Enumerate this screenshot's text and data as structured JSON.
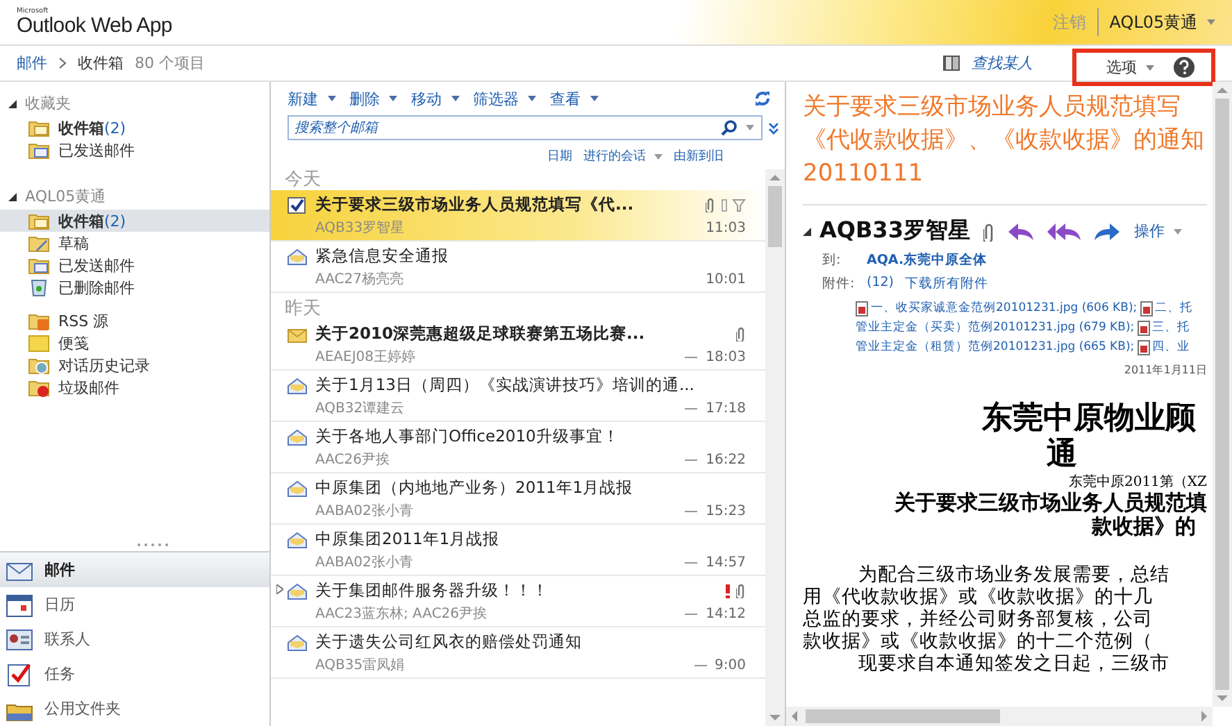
{
  "header": {
    "logo_small": "Microsoft",
    "logo": "Outlook Web App",
    "signout": "注销",
    "user": "AQL05黄通"
  },
  "breadcrumb": {
    "root": "邮件",
    "folder": "收件箱",
    "count": "80 个项目",
    "find_people": "查找某人",
    "options": "选项"
  },
  "favorites": {
    "title": "收藏夹",
    "expanded": true,
    "items": [
      {
        "label": "收件箱",
        "count": "(2)",
        "kind": "inbox",
        "selected": false,
        "bold": true
      },
      {
        "label": "已发送邮件",
        "kind": "sent",
        "selected": false,
        "bold": false
      }
    ]
  },
  "mailbox": {
    "title": "AQL05黄通",
    "expanded": true,
    "items": [
      {
        "label": "收件箱",
        "count": "(2)",
        "kind": "inbox",
        "selected": true,
        "bold": true
      },
      {
        "label": "草稿",
        "kind": "drafts",
        "selected": false,
        "bold": false
      },
      {
        "label": "已发送邮件",
        "kind": "sent",
        "selected": false,
        "bold": false
      },
      {
        "label": "已删除邮件",
        "kind": "deleted",
        "selected": false,
        "bold": false
      },
      {
        "label": "RSS 源",
        "kind": "rss",
        "selected": false,
        "bold": false
      },
      {
        "label": "便笺",
        "kind": "notes",
        "selected": false,
        "bold": false
      },
      {
        "label": "对话历史记录",
        "kind": "history",
        "selected": false,
        "bold": false
      },
      {
        "label": "垃圾邮件",
        "kind": "junk",
        "selected": false,
        "bold": false
      }
    ]
  },
  "nav": [
    {
      "label": "邮件",
      "kind": "mail",
      "selected": true
    },
    {
      "label": "日历",
      "kind": "calendar",
      "selected": false
    },
    {
      "label": "联系人",
      "kind": "contacts",
      "selected": false
    },
    {
      "label": "任务",
      "kind": "tasks",
      "selected": false
    },
    {
      "label": "公用文件夹",
      "kind": "public",
      "selected": false
    }
  ],
  "toolbar": [
    "新建",
    "删除",
    "移动",
    "筛选器",
    "查看"
  ],
  "search": {
    "placeholder": "搜索整个邮箱"
  },
  "sort": {
    "by": "日期",
    "group": "进行的会话",
    "order": "由新到旧"
  },
  "groups": [
    {
      "title": "今天",
      "messages": [
        {
          "subject": "关于要求三级市场业务人员规范填写《代...",
          "sender": "AQB33罗智星",
          "time": "11:03",
          "kind": "checked",
          "unread": true,
          "selected": true,
          "attachment": true,
          "important": false,
          "dash": false,
          "conversation": false
        },
        {
          "subject": "紧急信息安全通报",
          "sender": "AAC27杨亮亮",
          "time": "10:01",
          "kind": "read",
          "unread": false,
          "selected": false,
          "attachment": false,
          "important": false,
          "dash": false,
          "conversation": false
        }
      ]
    },
    {
      "title": "昨天",
      "messages": [
        {
          "subject": "关于2010深莞惠超级足球联赛第五场比赛...",
          "sender": "AEAEJ08王婷婷",
          "time": "18:03",
          "kind": "unread",
          "unread": true,
          "selected": false,
          "attachment": true,
          "important": false,
          "dash": true,
          "conversation": false
        },
        {
          "subject": "关于1月13日（周四）《实战演讲技巧》培训的通...",
          "sender": "AQB32谭建云",
          "time": "17:18",
          "kind": "read",
          "unread": false,
          "selected": false,
          "attachment": false,
          "important": false,
          "dash": true,
          "conversation": false
        },
        {
          "subject": "关于各地人事部门Office2010升级事宜！",
          "sender": "AAC26尹挨",
          "time": "16:22",
          "kind": "read",
          "unread": false,
          "selected": false,
          "attachment": false,
          "important": false,
          "dash": true,
          "conversation": false
        },
        {
          "subject": "中原集团（内地地产业务）2011年1月战报",
          "sender": "AABA02张小青",
          "time": "15:23",
          "kind": "read",
          "unread": false,
          "selected": false,
          "attachment": false,
          "important": false,
          "dash": true,
          "conversation": false
        },
        {
          "subject": "中原集团2011年1月战报",
          "sender": "AABA02张小青",
          "time": "14:57",
          "kind": "read",
          "unread": false,
          "selected": false,
          "attachment": false,
          "important": false,
          "dash": true,
          "conversation": false
        },
        {
          "subject": "关于集团邮件服务器升级！！！",
          "sender": "AAC23蓝东林; AAC26尹挨",
          "time": "14:12",
          "kind": "read",
          "unread": false,
          "selected": false,
          "attachment": true,
          "important": true,
          "dash": true,
          "conversation": true
        },
        {
          "subject": "关于遗失公司红风衣的赔偿处罚通知",
          "sender": "AQB35雷凤娟",
          "time": "9:00",
          "kind": "read",
          "unread": false,
          "selected": false,
          "attachment": false,
          "important": false,
          "dash": true,
          "conversation": false
        }
      ]
    }
  ],
  "reading": {
    "subject": "关于要求三级市场业务人员规范填写《代收款收据》、《收款收据》的通知20110111",
    "sender": "AQB33罗智星",
    "actions": "操作",
    "to_label": "到:",
    "to": "AQA.东莞中原全体",
    "att_label": "附件:",
    "att_count": "(12)",
    "download": "下载所有附件",
    "attachment_lines": [
      [
        {
          "text": "一、收买家诚意金范例20101231.jpg (606 KB);",
          "icon": true
        },
        {
          "text": "二、托",
          "icon": true
        }
      ],
      [
        {
          "text": "管业主定金（买卖）范例20101231.jpg (679 KB);",
          "icon": false
        },
        {
          "text": "三、托",
          "icon": true
        }
      ],
      [
        {
          "text": "管业主定金（租赁）范例20101231.jpg (665 KB);",
          "icon": false
        },
        {
          "text": "四、业",
          "icon": true
        }
      ]
    ],
    "date": "2011年1月11日",
    "doc_title": [
      "东莞中原物业顾",
      "通"
    ],
    "doc_number": "东莞中原2011第（XZ",
    "doc_heading": [
      "关于要求三级市场业务人员规范填",
      "款收据》的"
    ],
    "doc_body": [
      {
        "text": "为配合三级市场业务发展需要，总结",
        "indent": true
      },
      {
        "text": "用《代收款收据》或《收款收据》的十几",
        "indent": false
      },
      {
        "text": "总监的要求，并经公司财务部复核，公司",
        "indent": false
      },
      {
        "text": "款收据》或《收款收据》的十二个范例（",
        "indent": false
      },
      {
        "text": "现要求自本通知签发之日起，三级市",
        "indent": true
      }
    ]
  }
}
